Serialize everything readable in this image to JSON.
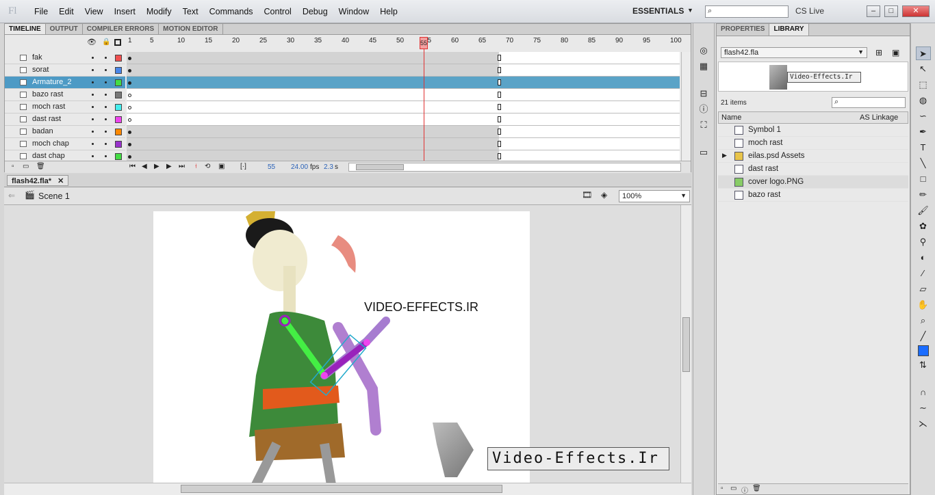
{
  "app": {
    "logo": "Fl",
    "workspace": "ESSENTIALS",
    "cslive": "CS Live"
  },
  "menu": [
    "File",
    "Edit",
    "View",
    "Insert",
    "Modify",
    "Text",
    "Commands",
    "Control",
    "Debug",
    "Window",
    "Help"
  ],
  "timeline": {
    "tabs": [
      "TIMELINE",
      "OUTPUT",
      "COMPILER ERRORS",
      "MOTION EDITOR"
    ],
    "ruler": [
      "1",
      "5",
      "10",
      "15",
      "20",
      "25",
      "30",
      "35",
      "40",
      "45",
      "50",
      "55",
      "60",
      "65",
      "70",
      "75",
      "80",
      "85",
      "90",
      "95",
      "100"
    ],
    "layers": [
      {
        "name": "fak",
        "color": "#f05050"
      },
      {
        "name": "sorat",
        "color": "#4a86e8"
      },
      {
        "name": "Armature_2",
        "color": "#44dd44"
      },
      {
        "name": "bazo rast",
        "color": "#777777"
      },
      {
        "name": "moch rast",
        "color": "#44eeee"
      },
      {
        "name": "dast rast",
        "color": "#ee44ee"
      },
      {
        "name": "badan",
        "color": "#ff8800"
      },
      {
        "name": "moch chap",
        "color": "#9933cc"
      },
      {
        "name": "dast chap",
        "color": "#44dd44"
      }
    ],
    "current_frame": "55",
    "fps": "24.00",
    "fps_unit": "fps",
    "time": "2.3",
    "time_unit": "s"
  },
  "document": {
    "tab": "flash42.fla*",
    "scene": "Scene 1",
    "zoom": "100%",
    "stage_text": "VIDEO-EFFECTS.IR",
    "watermark": "Video-Effects.Ir"
  },
  "library": {
    "tabs": [
      "PROPERTIES",
      "LIBRARY"
    ],
    "file": "flash42.fla",
    "count": "21 items",
    "col_name": "Name",
    "col_linkage": "AS Linkage",
    "banner": "Video-Effects.Ir",
    "items": [
      "Symbol 1",
      "moch rast",
      "eilas.psd Assets",
      "dast rast",
      "cover logo.PNG",
      "bazo rast"
    ]
  }
}
